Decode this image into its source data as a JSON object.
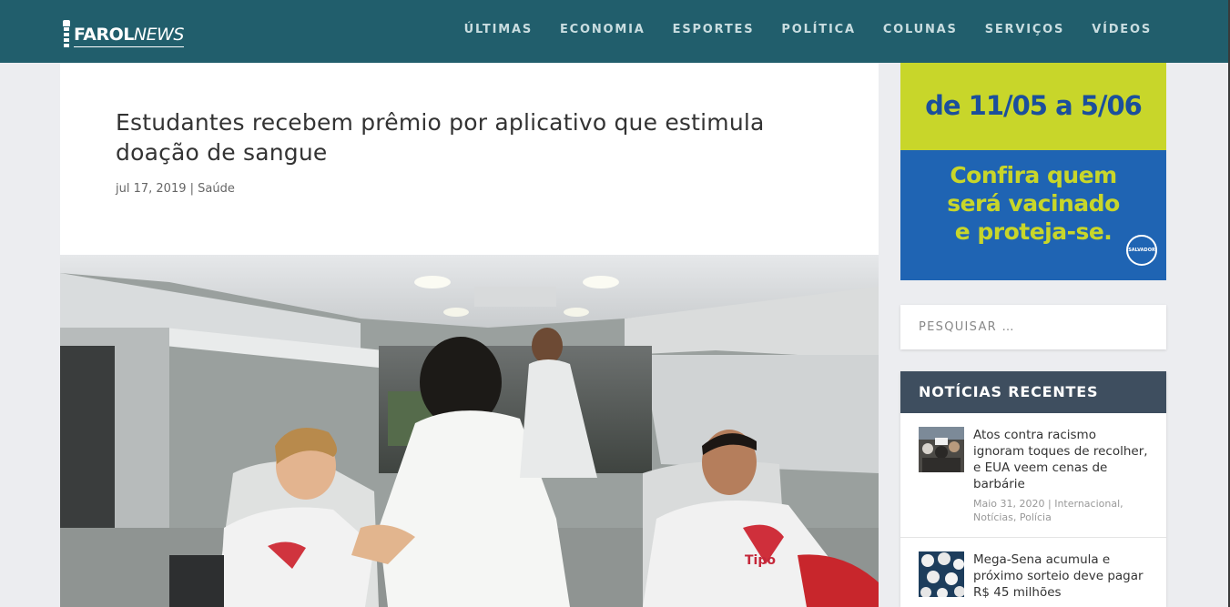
{
  "header": {
    "logo": {
      "word1": "FAROL",
      "word2": "NEWS"
    },
    "nav": [
      "ÚLTIMAS",
      "ECONOMIA",
      "ESPORTES",
      "POLÍTICA",
      "COLUNAS",
      "SERVIÇOS",
      "VÍDEOS"
    ]
  },
  "article": {
    "title": "Estudantes recebem prêmio por aplicativo que estimula doação de sangue",
    "date": "jul 17, 2019",
    "separator": "|",
    "category": "Saúde",
    "shirt_text": "Tipo"
  },
  "ad": {
    "dates": "de 11/05 a 5/06",
    "line1": "Confira quem",
    "line2": "será vacinado",
    "line3": "e proteja-se.",
    "seal": "SALVADOR"
  },
  "search": {
    "placeholder": "PESQUISAR …"
  },
  "recent": {
    "heading": "NOTÍCIAS RECENTES",
    "posts": [
      {
        "title": "Atos contra racismo ignoram toques de recolher, e EUA veem cenas de barbárie",
        "meta": "Maio 31, 2020 | Internacional, Notícias, Polícia"
      },
      {
        "title": "Mega-Sena acumula e próximo sorteio deve pagar R$ 45 milhões",
        "meta": ""
      }
    ]
  },
  "colors": {
    "header": "#215e6c",
    "widget_header": "#3e4e5f",
    "ad_lime": "#c8d62a",
    "ad_blue": "#1f64b3"
  }
}
